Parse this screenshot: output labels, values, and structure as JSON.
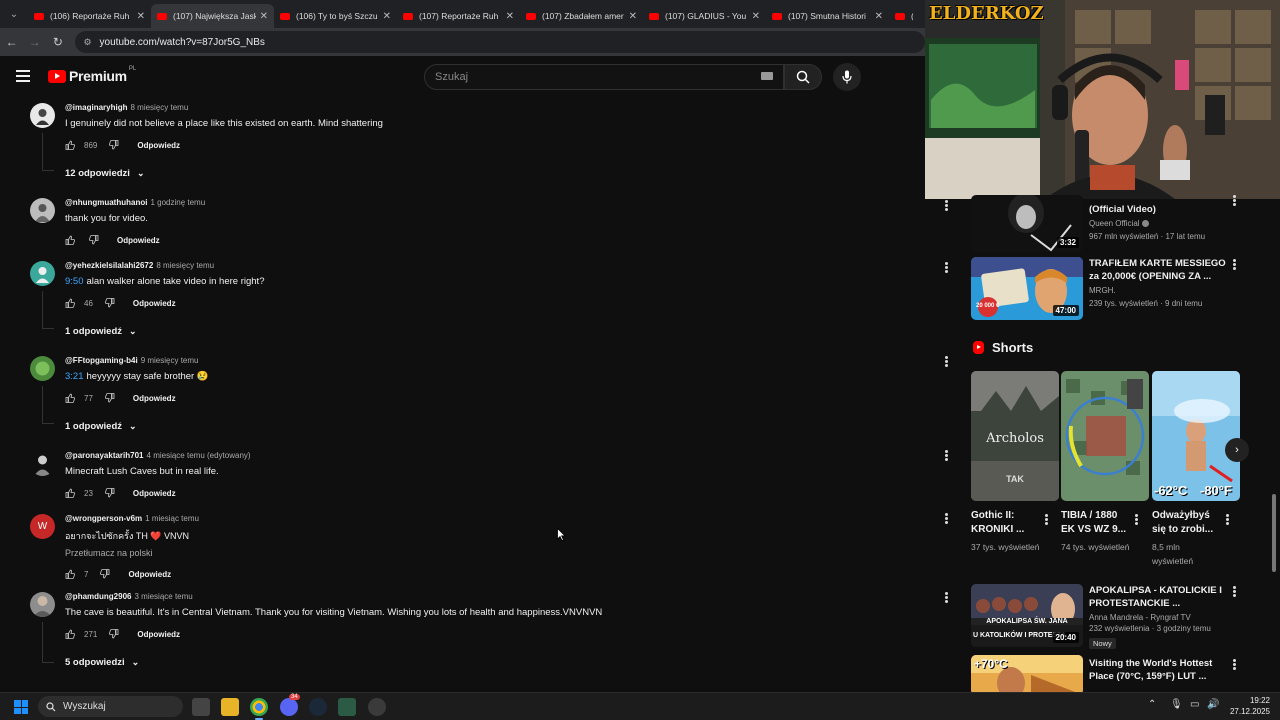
{
  "browser": {
    "tabs": [
      {
        "title": "(106) Reportaże Ruh"
      },
      {
        "title": "(107) Największa Jask"
      },
      {
        "title": "(106) Ty to byś Szczu"
      },
      {
        "title": "(107) Reportaże Ruh"
      },
      {
        "title": "(107) Zbadałem amer"
      },
      {
        "title": "(107) GLADIUS - You"
      },
      {
        "title": "(107) Smutna Histori"
      },
      {
        "title": "(107"
      }
    ],
    "url": "youtube.com/watch?v=87Jor5G_NBs"
  },
  "youtube": {
    "logo_text": "Premium",
    "country": "PL",
    "search_placeholder": "Szukaj"
  },
  "comments": [
    {
      "author": "@imaginaryhigh",
      "time": "8 miesięcy temu",
      "text": "I genuinely did not believe a place like this existed on earth. Mind shattering",
      "likes": "869",
      "reply": "Odpowiedz",
      "replies": "12 odpowiedzi"
    },
    {
      "author": "@nhungmuathuhanoi",
      "time": "1 godzinę temu",
      "text": "thank you for video.",
      "likes": "",
      "reply": "Odpowiedz"
    },
    {
      "author": "@yehezkielsilalahi2672",
      "time": "8 miesięcy temu",
      "timestamp": "9:50",
      "text": "alan walker alone take video in here right?",
      "likes": "46",
      "reply": "Odpowiedz",
      "replies": "1 odpowiedź"
    },
    {
      "author": "@FFtopgaming-b4i",
      "time": "9 miesięcy temu",
      "timestamp": "3:21",
      "text": "heyyyyy stay safe brother 😢",
      "likes": "77",
      "reply": "Odpowiedz",
      "replies": "1 odpowiedź"
    },
    {
      "author": "@paronayaktarih701",
      "time": "4 miesiące temu (edytowany)",
      "text": "Minecraft Lush Caves but in real life.",
      "likes": "23",
      "reply": "Odpowiedz"
    },
    {
      "author": "@wrongperson-v6m",
      "time": "1 miesiąc temu",
      "text": "อยากจะไปซักครั้ง TH ❤️ VNVN",
      "translate": "Przetłumacz na polski",
      "likes": "7",
      "reply": "Odpowiedz",
      "avatar_letter": "W"
    },
    {
      "author": "@phamdung2906",
      "time": "3 miesiące temu",
      "text": "The cave is beautiful. It's in Central Vietnam.  Thank you for visiting Vietnam. Wishing you lots of health and happiness.VNVNVN",
      "likes": "271",
      "reply": "Odpowiedz",
      "replies": "5 odpowiedzi"
    }
  ],
  "webcam": {
    "overlay_text": "ELDERKOZ"
  },
  "sidebar": {
    "videos_top": [
      {
        "title": "(Official Video)",
        "channel": "Queen Official",
        "stats": "967 mln wyświetleń · 17 lat temu",
        "duration": "3:32"
      },
      {
        "title": "TRAFIŁEM KARTE MESSIEGO za 20,000€ (OPENING ZA ...",
        "channel": "MRGH.",
        "stats": "239 tys. wyświetleń · 9 dni temu",
        "duration": "47:00",
        "thumb_badge": "20 000 €"
      }
    ],
    "shorts_title": "Shorts",
    "shorts": [
      {
        "title": "Gothic II: KRONIKI ...",
        "views": "37 tys. wyświetleń",
        "thumb_text": "Archolos",
        "thumb_sub": "TAK"
      },
      {
        "title": "TIBIA / 1880 EK VS WZ 9...",
        "views": "74 tys. wyświetleń"
      },
      {
        "title": "Odważyłbyś się to zrobi...",
        "views": "8,5 mln wyświetleń",
        "thumb_text_left": "-62°C",
        "thumb_text_right": "-80°F"
      }
    ],
    "videos_bottom": [
      {
        "title": "APOKALIPSA - KATOLICKIE I PROTESTANCKIE ...",
        "channel": "Anna Mandrela - Ryngraf TV",
        "stats": "232 wyświetlenia · 3 godziny temu",
        "duration": "20:40",
        "badge": "Nowy",
        "thumb_text": "APOKALIPSA ŚW. JANA",
        "thumb_sub": "U KATOLIKÓW I PROTESTA"
      },
      {
        "title": "Visiting the World's Hottest Place (70°C, 159°F) LUT ...",
        "thumb_text": "+70°C"
      }
    ]
  },
  "taskbar": {
    "search": "Wyszukaj",
    "time": "19:22",
    "date": "27.12.2025",
    "discord_badge": "34"
  },
  "colors": {
    "accent": "#ff0000",
    "link": "#3ea6ff",
    "background": "#0f0f0f"
  }
}
